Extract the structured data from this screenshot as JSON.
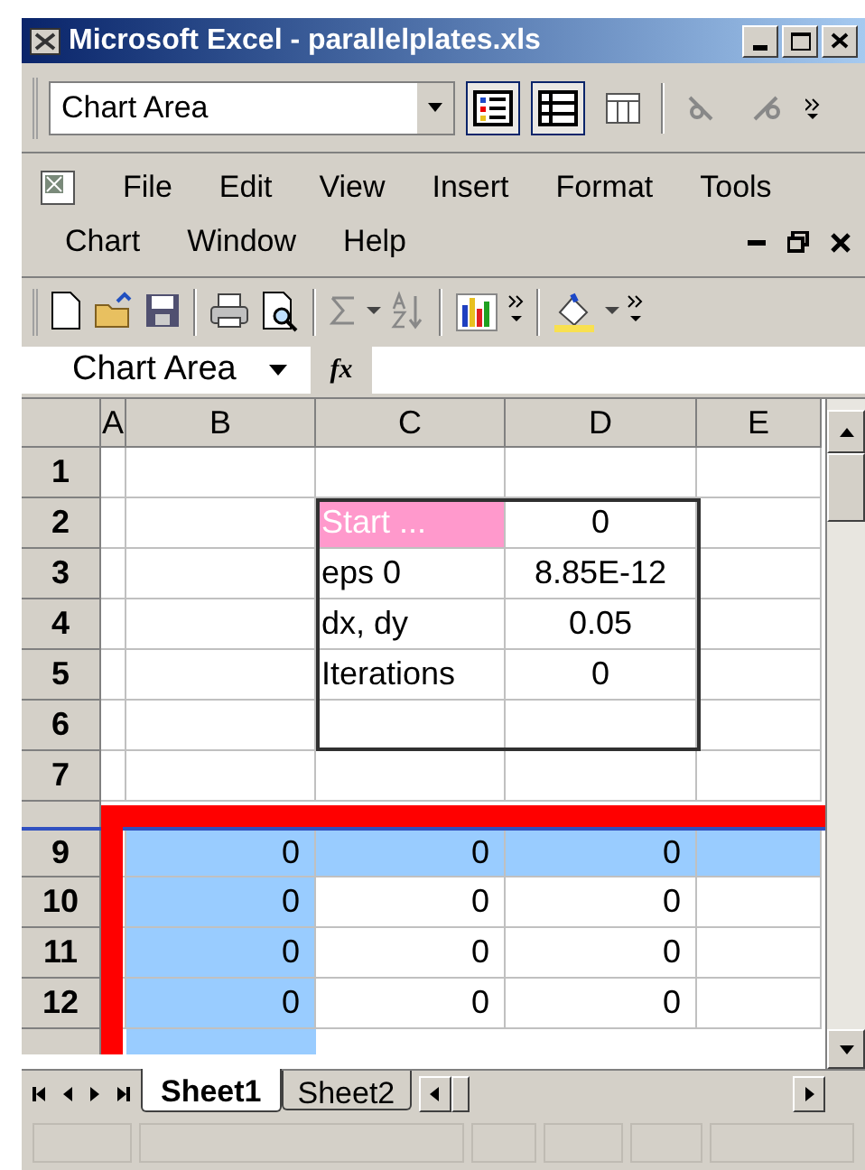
{
  "window": {
    "title": "Microsoft Excel - parallelplates.xls"
  },
  "chart_toolbar": {
    "object_box": {
      "value": "Chart Area"
    },
    "buttons": [
      {
        "kind": "legend",
        "pressed": true
      },
      {
        "kind": "table",
        "pressed": true
      },
      {
        "kind": "columns",
        "pressed": false
      },
      {
        "kind": "angle-down",
        "pressed": false
      },
      {
        "kind": "angle-up",
        "pressed": false
      }
    ]
  },
  "menu": {
    "rows": [
      [
        "File",
        "Edit",
        "View",
        "Insert",
        "Format",
        "Tools"
      ],
      [
        "Chart",
        "Window",
        "Help"
      ]
    ]
  },
  "standard_toolbar": {
    "groups": [
      [
        {
          "kind": "new"
        },
        {
          "kind": "open"
        },
        {
          "kind": "save"
        }
      ],
      [
        {
          "kind": "print"
        },
        {
          "kind": "preview"
        }
      ],
      [
        {
          "kind": "sum"
        },
        {
          "kind": "caret"
        },
        {
          "kind": "sort"
        }
      ],
      [
        {
          "kind": "chart"
        },
        {
          "kind": "more"
        }
      ],
      [
        {
          "kind": "fill"
        },
        {
          "kind": "caret"
        },
        {
          "kind": "more"
        }
      ]
    ]
  },
  "formula_bar": {
    "name_box": "Chart Area",
    "fx": "fx"
  },
  "sheet": {
    "columns": [
      "A",
      "B",
      "C",
      "D",
      "E"
    ],
    "rows": [
      {
        "label": "1",
        "kind": "blank",
        "cells": [
          {
            "text": "",
            "selected": false
          },
          {
            "text": "",
            "selected": false
          },
          {
            "text": "",
            "selected": false
          },
          {
            "text": "",
            "selected": false
          }
        ]
      },
      {
        "label": "2",
        "kind": "parameter",
        "cells": [
          {
            "text": "",
            "selected": false
          },
          {
            "text": "Start ...",
            "selected": false,
            "highlighted": true
          },
          {
            "text": "0",
            "selected": false
          },
          {
            "text": "",
            "selected": false
          }
        ]
      },
      {
        "label": "3",
        "kind": "parameter",
        "cells": [
          {
            "text": "",
            "selected": false
          },
          {
            "text": "eps 0",
            "selected": false
          },
          {
            "text": "8.85E-12",
            "selected": false
          },
          {
            "text": "",
            "selected": false
          }
        ]
      },
      {
        "label": "4",
        "kind": "parameter",
        "cells": [
          {
            "text": "",
            "selected": false
          },
          {
            "text": "dx, dy",
            "selected": false
          },
          {
            "text": "0.05",
            "selected": false
          },
          {
            "text": "",
            "selected": false
          }
        ]
      },
      {
        "label": "5",
        "kind": "parameter",
        "cells": [
          {
            "text": "",
            "selected": false
          },
          {
            "text": "Iterations",
            "selected": false
          },
          {
            "text": "0",
            "selected": false
          },
          {
            "text": "",
            "selected": false
          }
        ]
      },
      {
        "label": "6",
        "kind": "blank",
        "cells": [
          {
            "text": "",
            "selected": false
          },
          {
            "text": "",
            "selected": false
          },
          {
            "text": "",
            "selected": false
          },
          {
            "text": "",
            "selected": false
          }
        ]
      },
      {
        "label": "7",
        "kind": "blank",
        "cells": [
          {
            "text": "",
            "selected": false
          },
          {
            "text": "",
            "selected": false
          },
          {
            "text": "",
            "selected": false
          },
          {
            "text": "",
            "selected": false
          }
        ]
      },
      {
        "label": "9",
        "kind": "grid",
        "cells": [
          {
            "text": "0",
            "selected": true
          },
          {
            "text": "0",
            "selected": true
          },
          {
            "text": "0",
            "selected": true
          },
          {
            "text": "",
            "selected": true
          }
        ]
      },
      {
        "label": "10",
        "kind": "grid",
        "cells": [
          {
            "text": "0",
            "selected": true
          },
          {
            "text": "0",
            "selected": false
          },
          {
            "text": "0",
            "selected": false
          },
          {
            "text": "",
            "selected": false
          }
        ]
      },
      {
        "label": "11",
        "kind": "grid",
        "cells": [
          {
            "text": "0",
            "selected": true
          },
          {
            "text": "0",
            "selected": false
          },
          {
            "text": "0",
            "selected": false
          },
          {
            "text": "",
            "selected": false
          }
        ]
      },
      {
        "label": "12",
        "kind": "grid",
        "cells": [
          {
            "text": "0",
            "selected": true
          },
          {
            "text": "0",
            "selected": false
          },
          {
            "text": "0",
            "selected": false
          },
          {
            "text": "",
            "selected": false
          }
        ]
      }
    ]
  },
  "sheet_tabs": [
    {
      "label": "Sheet1",
      "selected": true
    },
    {
      "label": "Sheet2",
      "selected": false
    }
  ]
}
